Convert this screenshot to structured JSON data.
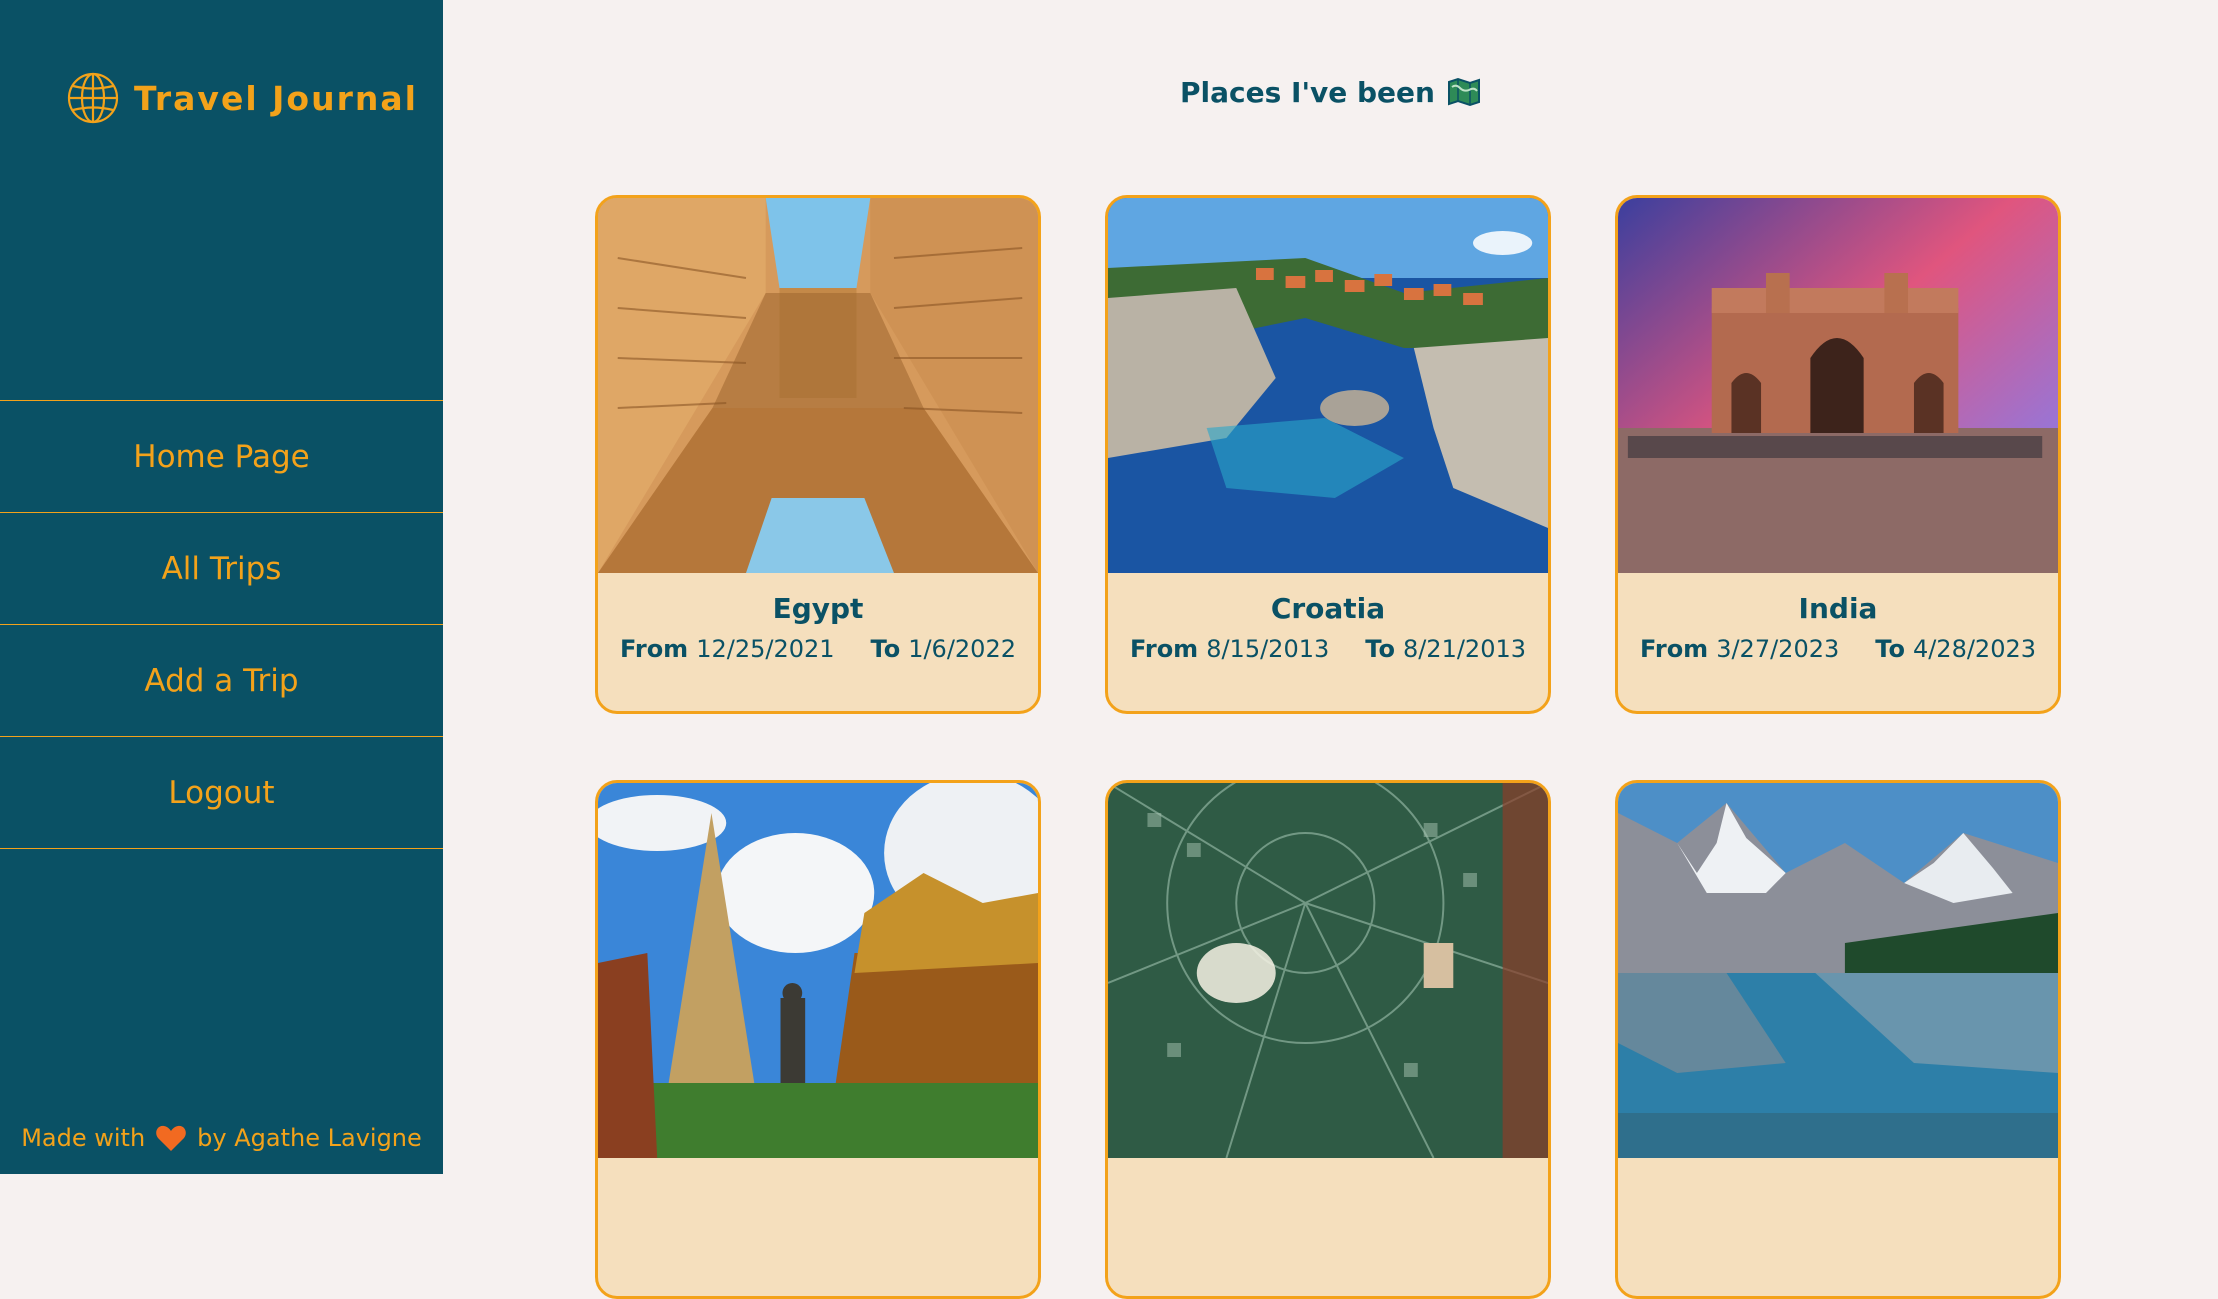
{
  "sidebar": {
    "brand": "Travel Journal",
    "nav": [
      {
        "label": "Home Page"
      },
      {
        "label": "All Trips"
      },
      {
        "label": "Add a Trip"
      },
      {
        "label": "Logout"
      }
    ],
    "footer": {
      "prefix": "Made with",
      "suffix": "by Agathe Lavigne"
    }
  },
  "main": {
    "heading": "Places I've been",
    "trips": [
      {
        "name": "Egypt",
        "from_label": "From",
        "from": "12/25/2021",
        "to_label": "To",
        "to": "1/6/2022"
      },
      {
        "name": "Croatia",
        "from_label": "From",
        "from": "8/15/2013",
        "to_label": "To",
        "to": "8/21/2013"
      },
      {
        "name": "India",
        "from_label": "From",
        "from": "3/27/2023",
        "to_label": "To",
        "to": "4/28/2023"
      },
      {
        "name": "",
        "from_label": "",
        "from": "",
        "to_label": "",
        "to": ""
      },
      {
        "name": "",
        "from_label": "",
        "from": "",
        "to_label": "",
        "to": ""
      },
      {
        "name": "",
        "from_label": "",
        "from": "",
        "to_label": "",
        "to": ""
      }
    ]
  },
  "colors": {
    "sidebar_bg": "#0a5165",
    "accent": "#f3a21a",
    "page_bg": "#f6f1f0",
    "card_bg": "#f5dfbd",
    "heart": "#f26a21"
  }
}
